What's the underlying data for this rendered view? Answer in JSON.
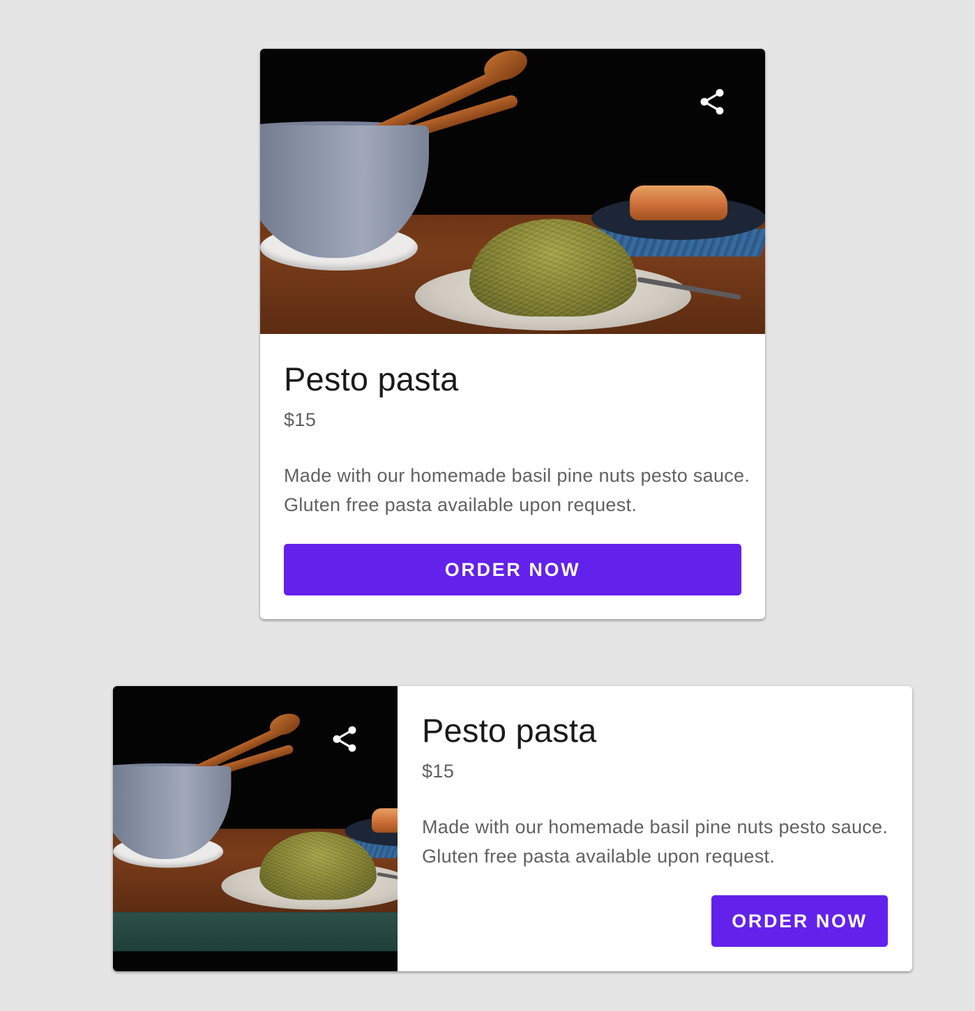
{
  "cards": [
    {
      "variant": "vertical",
      "image_alt": "Pesto pasta",
      "share_icon": "share-icon",
      "title": "Pesto pasta",
      "price": "$15",
      "description": "Made with our homemade basil pine nuts pesto sauce. Gluten free pasta available upon request.",
      "button_label": "ORDER NOW"
    },
    {
      "variant": "horizontal",
      "image_alt": "Pesto pasta",
      "share_icon": "share-icon",
      "title": "Pesto pasta",
      "price": "$15",
      "description": "Made with our homemade basil pine nuts pesto sauce. Gluten free pasta available upon request.",
      "button_label": "ORDER NOW"
    }
  ],
  "colors": {
    "background": "#e5e5e5",
    "card": "#ffffff",
    "button": "#6321ec",
    "button_text": "#ffffff",
    "title_text": "#1a1a1a",
    "body_text": "#616161"
  }
}
